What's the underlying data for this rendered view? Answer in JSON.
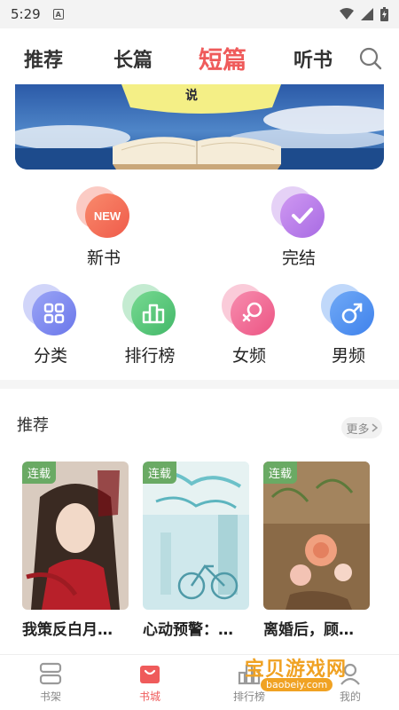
{
  "status": {
    "time": "5:29",
    "a_label": "A"
  },
  "tabs": [
    {
      "label": "推荐"
    },
    {
      "label": "长篇"
    },
    {
      "label": "短篇"
    },
    {
      "label": "听书"
    }
  ],
  "banner": {
    "text": "说"
  },
  "entries_row1": [
    {
      "label": "新书",
      "icon": "new-icon",
      "color": "#f36b55"
    },
    {
      "label": "完结",
      "icon": "check-icon",
      "color": "#b57be6"
    }
  ],
  "entries_row2": [
    {
      "label": "分类",
      "icon": "grid-icon",
      "color": "#7b86ef"
    },
    {
      "label": "排行榜",
      "icon": "chart-icon",
      "color": "#55c67a"
    },
    {
      "label": "女频",
      "icon": "female-icon",
      "color": "#f06a93"
    },
    {
      "label": "男频",
      "icon": "male-icon",
      "color": "#4a8ef0"
    }
  ],
  "recommend": {
    "title": "推荐",
    "more": "更多",
    "books": [
      {
        "badge": "连载",
        "title": "我策反白月…"
      },
      {
        "badge": "连载",
        "title": "心动预警：…"
      },
      {
        "badge": "连载",
        "title": "离婚后，顾…"
      }
    ]
  },
  "nav": [
    {
      "label": "书架"
    },
    {
      "label": "书城"
    },
    {
      "label": "排行榜"
    },
    {
      "label": "我的"
    }
  ],
  "watermark": {
    "text": "宝贝游戏网",
    "url": "baobeiy.com"
  },
  "colors": {
    "accent": "#ef5b5b",
    "badge": "#6aaa64"
  }
}
